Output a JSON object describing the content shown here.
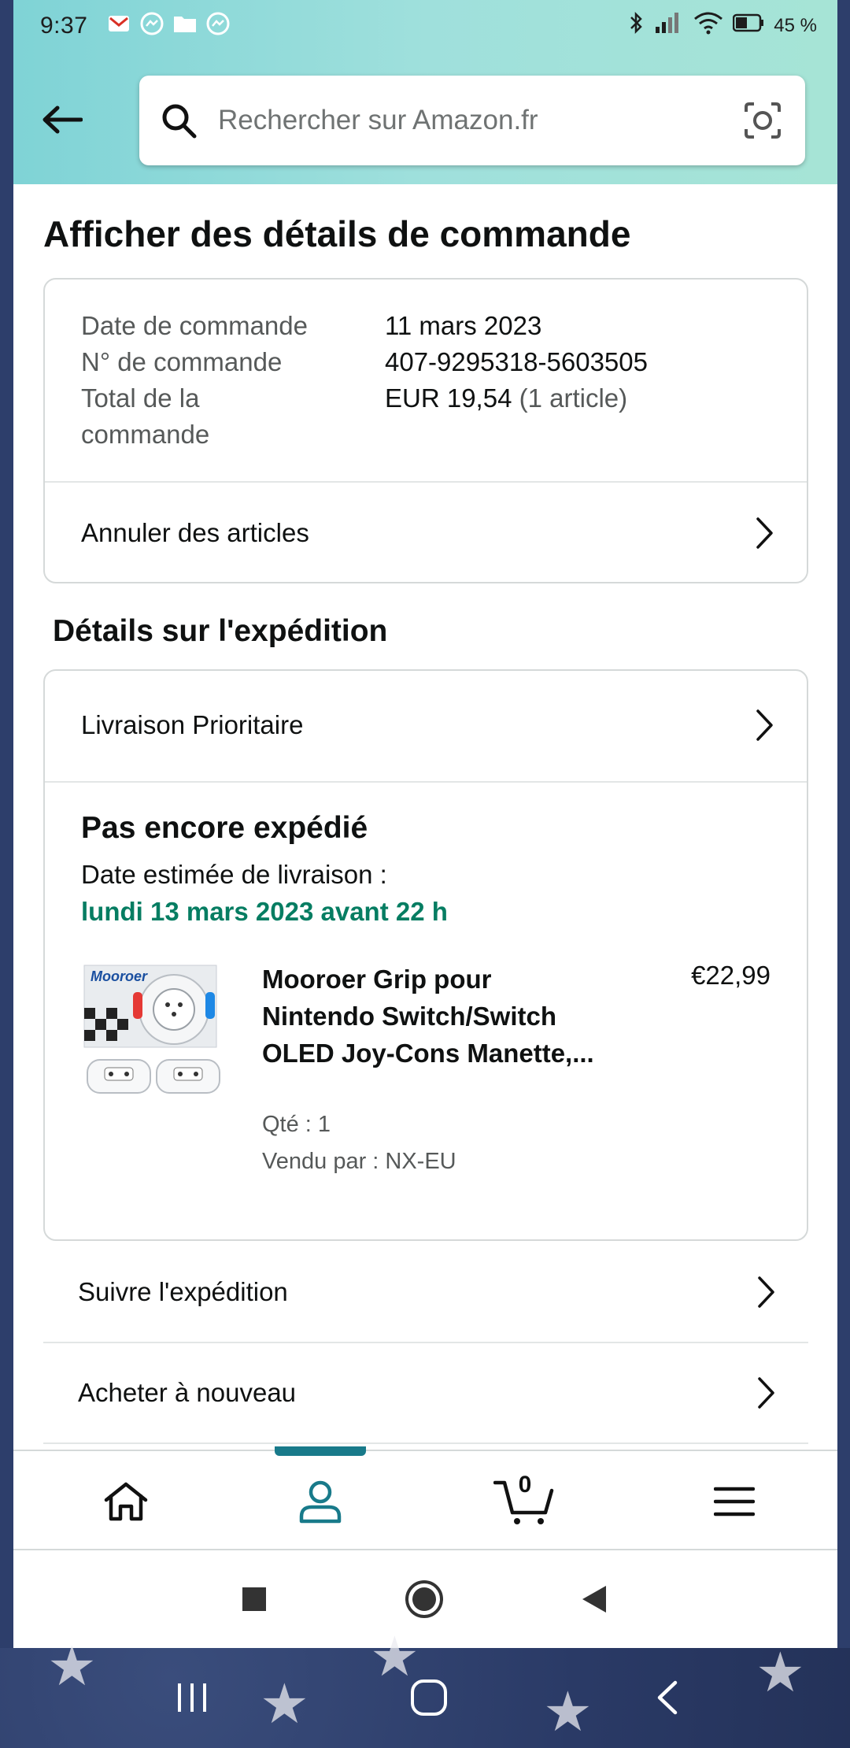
{
  "status_bar": {
    "time": "9:37",
    "battery": "45 %",
    "icons": [
      "gmail-icon",
      "messenger-icon",
      "folder-icon",
      "messenger-icon",
      "bluetooth-icon",
      "signal-icon",
      "wifi-icon",
      "battery-icon"
    ]
  },
  "header": {
    "search_placeholder": "Rechercher sur Amazon.fr"
  },
  "page": {
    "title": "Afficher des détails de commande"
  },
  "order_summary": {
    "rows": [
      {
        "label": "Date de commande",
        "value": "11 mars 2023"
      },
      {
        "label": "N° de commande",
        "value": "407-9295318-5603505"
      },
      {
        "label": "Total de la commande",
        "value": "EUR 19,54",
        "value_note": "(1 article)"
      }
    ],
    "cancel_label": "Annuler des articles"
  },
  "shipment": {
    "section_title": "Détails sur l'expédition",
    "delivery_option": "Livraison Prioritaire",
    "status": "Pas encore expédié",
    "estimate_label": "Date estimée de livraison :",
    "estimate_date": "lundi 13 mars 2023 avant 22 h",
    "product": {
      "title": "Mooroer Grip pour Nintendo Switch/Switch OLED Joy-Cons Manette,...",
      "price": "€22,99",
      "qty": "Qté : 1",
      "seller": "Vendu par : NX-EU",
      "image_brand_text": "Mooroer"
    }
  },
  "actions": {
    "track_label": "Suivre l'expédition",
    "buy_again_label": "Acheter à nouveau"
  },
  "bottom_nav": {
    "items": [
      "home-icon",
      "account-icon",
      "cart-icon",
      "menu-icon"
    ],
    "cart_count": "0",
    "active": "account-icon",
    "accent_color": "#187a8a"
  },
  "colors": {
    "delivery_green": "#067d62",
    "header_gradient": [
      "#7fd3d6",
      "#a6e4d6"
    ]
  }
}
